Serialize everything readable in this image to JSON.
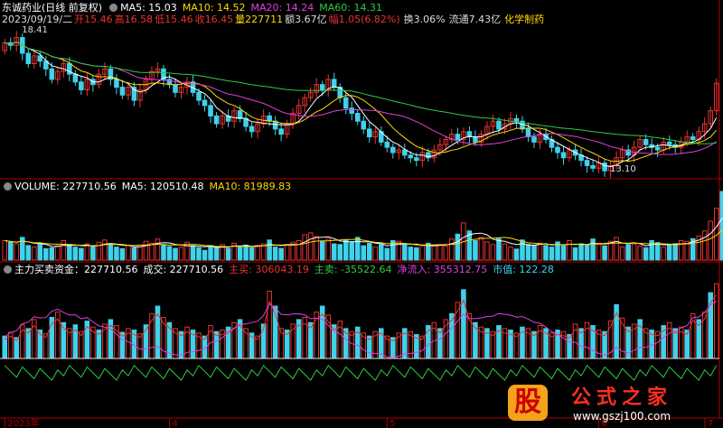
{
  "header": {
    "stock_name": "东诚药业(日线 前复权)",
    "ma5": "MA5: 15.03",
    "ma10": "MA10: 14.52",
    "ma20": "MA20: 14.24",
    "ma60": "MA60: 14.31"
  },
  "quote": {
    "date": "2023/09/19/二",
    "open": "开15.46",
    "high": "高16.58",
    "low": "低15.46",
    "close": "收16.45",
    "volume": "量227711",
    "amount": "额3.67亿",
    "change": "幅1.05(6.82%)",
    "turnover": "换3.06%",
    "float_value": "流通7.43亿",
    "sector": "化学制药"
  },
  "volume_panel": {
    "volume": "VOLUME: 227710.56",
    "ma5": "MA5: 120510.48",
    "ma10": "MA10: 81989.83"
  },
  "fund_panel": {
    "name": "主力买卖资金：227710.56",
    "deal": "成交: 227710.56",
    "buy": "主买: 306043.19",
    "sell": "主卖: -35522.64",
    "net": "净流入: 355312.75",
    "market": "市值: 122.28"
  },
  "colors": {
    "up": "#e8332f",
    "down": "#3fd2ea",
    "ma5": "#ffffff",
    "ma10": "#ffd700",
    "ma20": "#e040e0",
    "ma60": "#2ecc40",
    "axis": "#b00000"
  },
  "watermark": {
    "badge": "股",
    "site_name": "公式之家",
    "url": "www.gszj100.com"
  },
  "chart_data": [
    {
      "type": "candlestick",
      "title": "东诚药业(日线 前复权)",
      "annotations": {
        "high_label": "18.41",
        "low_label": "13.10"
      },
      "series_names": [
        "MA5",
        "MA10",
        "MA20",
        "MA60"
      ],
      "x_ticks": [
        "2023年",
        "4",
        "5",
        "6",
        "7"
      ],
      "close": [
        18.0,
        17.9,
        18.2,
        17.6,
        17.2,
        17.5,
        17.3,
        17.0,
        16.6,
        16.9,
        17.2,
        16.8,
        16.5,
        16.2,
        16.6,
        16.4,
        16.8,
        17.0,
        16.6,
        16.3,
        16.0,
        16.3,
        15.8,
        16.2,
        16.6,
        16.9,
        17.0,
        16.6,
        16.4,
        16.1,
        16.3,
        16.5,
        16.1,
        15.8,
        15.6,
        15.2,
        14.9,
        15.2,
        15.0,
        15.4,
        15.1,
        14.8,
        14.6,
        14.9,
        15.2,
        15.0,
        14.7,
        14.5,
        14.9,
        15.3,
        15.6,
        15.9,
        16.1,
        16.4,
        16.2,
        16.6,
        16.3,
        15.9,
        15.5,
        15.3,
        15.0,
        14.7,
        14.4,
        14.6,
        14.2,
        14.0,
        13.8,
        13.9,
        13.7,
        13.6,
        13.5,
        13.8,
        13.6,
        13.9,
        14.1,
        14.3,
        14.5,
        14.3,
        14.6,
        14.4,
        14.2,
        14.5,
        14.8,
        15.0,
        14.7,
        14.9,
        15.1,
        15.0,
        14.7,
        14.4,
        14.2,
        14.5,
        14.3,
        14.0,
        13.8,
        13.6,
        13.9,
        13.7,
        13.5,
        13.3,
        13.2,
        13.4,
        13.1,
        13.3,
        13.6,
        13.9,
        13.7,
        14.0,
        14.3,
        14.1,
        14.0,
        13.9,
        14.2,
        14.1,
        14.0,
        14.2,
        14.4,
        14.3,
        14.6,
        14.9,
        15.4,
        16.45
      ],
      "volume": [
        60,
        55,
        50,
        70,
        45,
        40,
        52,
        35,
        38,
        44,
        60,
        48,
        40,
        36,
        50,
        42,
        55,
        62,
        47,
        40,
        35,
        45,
        38,
        46,
        58,
        52,
        65,
        48,
        42,
        36,
        40,
        55,
        44,
        38,
        30,
        45,
        40,
        48,
        36,
        52,
        42,
        46,
        38,
        44,
        50,
        62,
        40,
        36,
        48,
        55,
        60,
        78,
        84,
        72,
        58,
        66,
        50,
        48,
        62,
        56,
        70,
        44,
        52,
        40,
        48,
        36,
        60,
        58,
        50,
        40,
        38,
        44,
        52,
        46,
        48,
        42,
        65,
        80,
        115,
        90,
        60,
        70,
        56,
        48,
        66,
        50,
        40,
        34,
        62,
        48,
        46,
        52,
        45,
        40,
        56,
        44,
        60,
        38,
        50,
        46,
        65,
        52,
        44,
        58,
        70,
        40,
        48,
        50,
        44,
        38,
        60,
        54,
        40,
        46,
        50,
        60,
        58,
        66,
        74,
        90,
        120,
        160,
        212
      ]
    },
    {
      "type": "bar",
      "title": "主力买卖资金",
      "values": [
        0.3,
        0.35,
        0.28,
        0.45,
        0.4,
        0.52,
        0.38,
        0.33,
        0.55,
        0.62,
        0.48,
        0.4,
        0.45,
        0.36,
        0.5,
        0.42,
        0.38,
        0.46,
        0.52,
        0.44,
        0.35,
        0.4,
        0.38,
        0.33,
        0.45,
        0.6,
        0.7,
        0.55,
        0.48,
        0.4,
        0.36,
        0.42,
        0.38,
        0.34,
        0.3,
        0.44,
        0.36,
        0.38,
        0.42,
        0.48,
        0.52,
        0.4,
        0.34,
        0.3,
        0.46,
        0.9,
        0.7,
        0.4,
        0.38,
        0.46,
        0.52,
        0.55,
        0.48,
        0.62,
        0.7,
        0.58,
        0.45,
        0.5,
        0.4,
        0.36,
        0.42,
        0.34,
        0.3,
        0.36,
        0.4,
        0.3,
        0.28,
        0.34,
        0.4,
        0.36,
        0.32,
        0.3,
        0.44,
        0.48,
        0.4,
        0.52,
        0.6,
        0.75,
        0.92,
        0.6,
        0.48,
        0.42,
        0.4,
        0.36,
        0.44,
        0.4,
        0.38,
        0.34,
        0.42,
        0.4,
        0.36,
        0.44,
        0.4,
        0.34,
        0.38,
        0.36,
        0.32,
        0.46,
        0.4,
        0.48,
        0.44,
        0.38,
        0.36,
        0.5,
        0.72,
        0.54,
        0.42,
        0.46,
        0.52,
        0.4,
        0.38,
        0.36,
        0.44,
        0.48,
        0.4,
        0.42,
        0.38,
        0.6,
        0.52,
        0.62,
        0.88,
        1.0
      ],
      "series_names": [
        "主买",
        "主卖",
        "净流入"
      ]
    }
  ]
}
